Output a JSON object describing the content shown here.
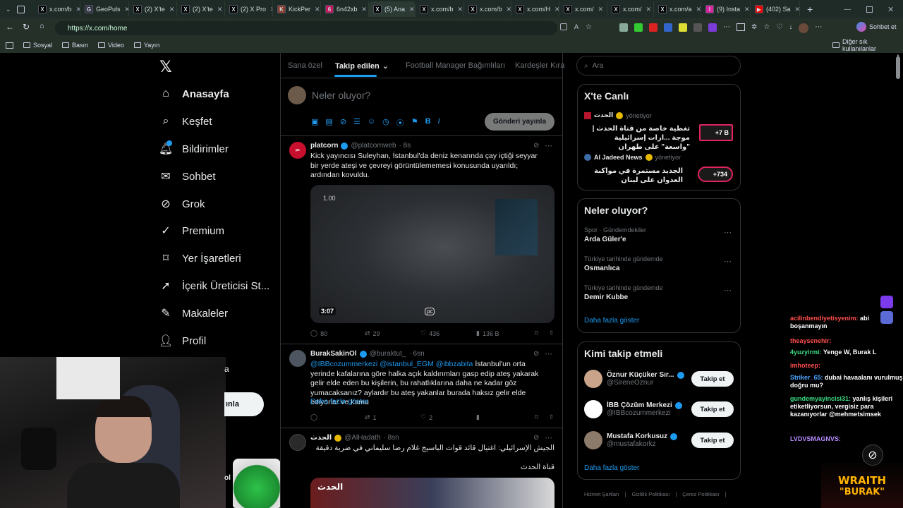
{
  "browser": {
    "tabs": [
      {
        "label": "x.com/b",
        "fav": "X",
        "bg": "#000"
      },
      {
        "label": "GeoPuls",
        "fav": "G",
        "bg": "#334"
      },
      {
        "label": "(2) X'te",
        "fav": "X",
        "bg": "#000"
      },
      {
        "label": "(2) X'te",
        "fav": "X",
        "bg": "#000"
      },
      {
        "label": "(2) X Pro",
        "fav": "X",
        "bg": "#000"
      },
      {
        "label": "KickPer",
        "fav": "K",
        "bg": "#8a3a2a"
      },
      {
        "label": "6n42xb",
        "fav": "6",
        "bg": "#c2185b"
      },
      {
        "label": "(5) Ana",
        "fav": "X",
        "bg": "#000"
      },
      {
        "label": "x.com/b",
        "fav": "X",
        "bg": "#000"
      },
      {
        "label": "x.com/b",
        "fav": "X",
        "bg": "#000"
      },
      {
        "label": "x.com/H",
        "fav": "X",
        "bg": "#000"
      },
      {
        "label": "x.com/",
        "fav": "X",
        "bg": "#000"
      },
      {
        "label": "x.com/",
        "fav": "X",
        "bg": "#000"
      },
      {
        "label": "x.com/a",
        "fav": "X",
        "bg": "#000"
      },
      {
        "label": "(9) Insta",
        "fav": "I",
        "bg": "#d6249f"
      },
      {
        "label": "(402) Sa",
        "fav": "▶",
        "bg": "#e00"
      }
    ],
    "url": "https://x.com/home",
    "chat_button": "Sohbet et",
    "bookmarks": [
      "Sosyal",
      "Basın",
      "Video",
      "Yayın"
    ],
    "other_bookmarks": "Diğer sık kullanılanlar"
  },
  "sidebar": {
    "items": [
      "Anasayfa",
      "Keşfet",
      "Bildirimler",
      "Sohbet",
      "Grok",
      "Premium",
      "Yer İşaretleri",
      "İçerik Üreticisi St...",
      "Makaleler",
      "Profil"
    ],
    "post_button_partial": "ınla",
    "more_partial": "a"
  },
  "feed": {
    "tabs": [
      "Sana özel",
      "Takip edilen",
      "Football Manager Bağımlıları",
      "Kardeşler Kıra"
    ],
    "compose_placeholder": "Neler oluyor?",
    "post_button": "Gönderi yayınla",
    "tweets": [
      {
        "name": "platcorn",
        "handle": "@platcornweb",
        "time": "· 8s",
        "text": "Kick yayıncısı Suleyhan, İstanbul'da deniz kenarında çay içtiği seyyar bir yerde ateşi ve çevreyi görüntülememesi konusunda uyarıldı; ardından kovuldu.",
        "video_speed": "1.00",
        "video_duration": "3:07",
        "replies": "80",
        "reposts": "29",
        "likes": "436",
        "views": "136 B"
      },
      {
        "name": "BurakSakinOl",
        "handle": "@buraktut_",
        "time": "· 6sn",
        "mentions": "@IBBcozummerkezi @istanbul_EGM @ibbzabita",
        "text": "İstanbul'un orta yerinde kafalarına göre halka açık kaldırımları gasp edip ateş yakarak gelir elde eden bu kişilerin, bu rahatlıklarına daha ne kadar göz yumacaksanız? aylardır bu ateş yakanlar burada haksız gelir elde ediyorlar ve kamu",
        "more": "Daha fazla göster",
        "replies": "",
        "reposts": "1",
        "likes": "2",
        "views": ""
      },
      {
        "name": "الحدث",
        "handle": "@AlHadath",
        "time": "· 8sn",
        "text": "الجيش الإسرائيلي: اغتيال قائد قوات الباسيج غلام رضا سليماني في ضربة دقيقة",
        "source": "قناة الحدث",
        "image_caption": "الحدث"
      }
    ]
  },
  "right": {
    "search_placeholder": "Ara",
    "live": {
      "title": "X'te Canlı",
      "items": [
        {
          "host": "الحدث",
          "status": "yönetiyor",
          "text": "تغطية خاصة من قناة الحدث | موجة ...ارات إسرائيلية \"واسعة\" على طهران",
          "count": "+7 B"
        },
        {
          "host": "Al Jadeed News",
          "status": "yönetiyor",
          "text": "الجديد مستمرة في مواكبة العدوان على لبنان",
          "count": "+734"
        }
      ]
    },
    "trends": {
      "title": "Neler oluyor?",
      "items": [
        {
          "category": "Spor · Gündemdekiler",
          "name": "Arda Güler'e"
        },
        {
          "category": "Türkiye tarihinde gündemde",
          "name": "Osmanlıca"
        },
        {
          "category": "Türkiye tarihinde gündemde",
          "name": "Demir Kubbe"
        }
      ],
      "more": "Daha fazla göster"
    },
    "who_to_follow": {
      "title": "Kimi takip etmeli",
      "users": [
        {
          "name": "Öznur Küçüker Sır...",
          "handle": "@SireneOznur"
        },
        {
          "name": "İBB Çözüm Merkezi",
          "handle": "@IBBcozummerkezi"
        },
        {
          "name": "Mustafa Korkusuz",
          "handle": "@mustafakorkz"
        }
      ],
      "follow_label": "Takip et",
      "more": "Daha fazla göster"
    },
    "footer": [
      "Hizmet Şartları",
      "Gizlilik Politikası",
      "Çerez Politikası"
    ]
  },
  "chat": {
    "messages": [
      {
        "user": "acilinbendiyetisyenim:",
        "text": " abi boşanmayın",
        "color": "#ff4d4d"
      },
      {
        "user": "theaysenehir:",
        "text": "",
        "color": "#ff4d4d"
      },
      {
        "user": "4yuzyirmi:",
        "text": " Yenge W, Burak L",
        "color": "#3ddc84"
      },
      {
        "user": "imhoteep:",
        "text": "",
        "color": "#ff4d4d"
      },
      {
        "user": "Striker_65:",
        "text": " dubai havaalanı vurulmuş doğru mu?",
        "color": "#4aa3ff"
      },
      {
        "user": "gundemyayincisi31:",
        "text": " yanlış kişileri etiketliyorsun, vergisiz para kazanıyorlar @mehmetsimsek",
        "color": "#3ddc84"
      },
      {
        "user": "LVDVSMAGNVS:",
        "text": "",
        "color": "#b58cff"
      }
    ]
  },
  "stream": {
    "logo_top": "WRAITH",
    "logo_bottom": "\"BURAK\""
  }
}
